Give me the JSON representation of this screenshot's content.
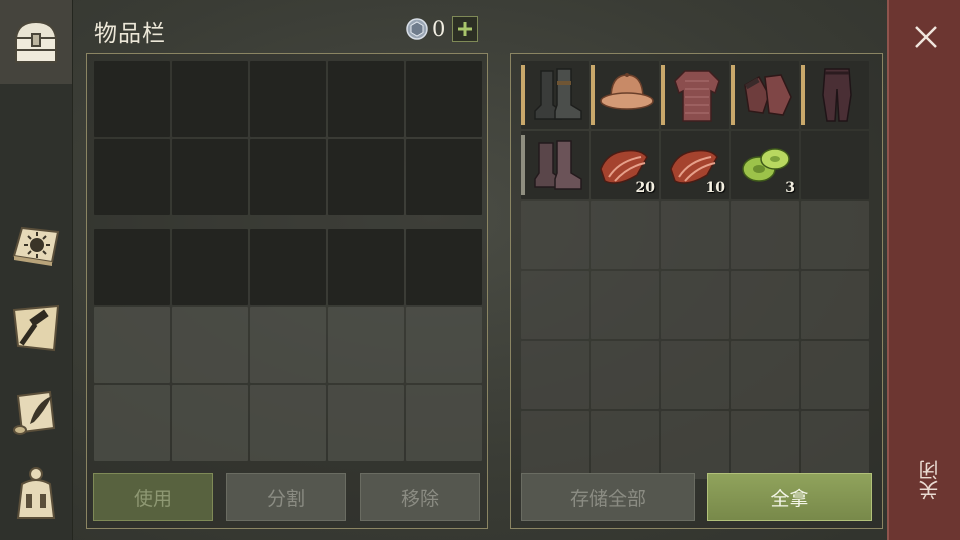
{
  "header": {
    "title": "物品栏",
    "currency_icon": "hexagon-gem-icon",
    "currency_count": "0",
    "add_icon": "plus-icon"
  },
  "sidebar": {
    "items": [
      {
        "icon": "chest-icon",
        "active": true
      },
      {
        "icon": "sun-book-icon"
      },
      {
        "icon": "hammer-map-icon"
      },
      {
        "icon": "scroll-quill-icon"
      },
      {
        "icon": "backpack-icon"
      }
    ]
  },
  "container": {
    "items": [
      {
        "icon": "boots-icon",
        "qty": ""
      },
      {
        "icon": "helmet-icon",
        "qty": ""
      },
      {
        "icon": "chainmail-icon",
        "qty": ""
      },
      {
        "icon": "gloves-icon",
        "qty": ""
      },
      {
        "icon": "pants-icon",
        "qty": ""
      },
      {
        "icon": "boots-icon",
        "qty": ""
      },
      {
        "icon": "meat-icon",
        "qty": "20"
      },
      {
        "icon": "meat-icon",
        "qty": "10"
      },
      {
        "icon": "cabbage-icon",
        "qty": "3"
      }
    ]
  },
  "buttons": {
    "use": "使用",
    "split": "分割",
    "remove": "移除",
    "store_all": "存储全部",
    "take_all": "全拿"
  },
  "close": {
    "icon": "close-icon",
    "label": "关闭"
  },
  "colors": {
    "accent_green": "#8da05a",
    "close_rail": "#6c3631",
    "gold_bar": "#c9a86b"
  }
}
